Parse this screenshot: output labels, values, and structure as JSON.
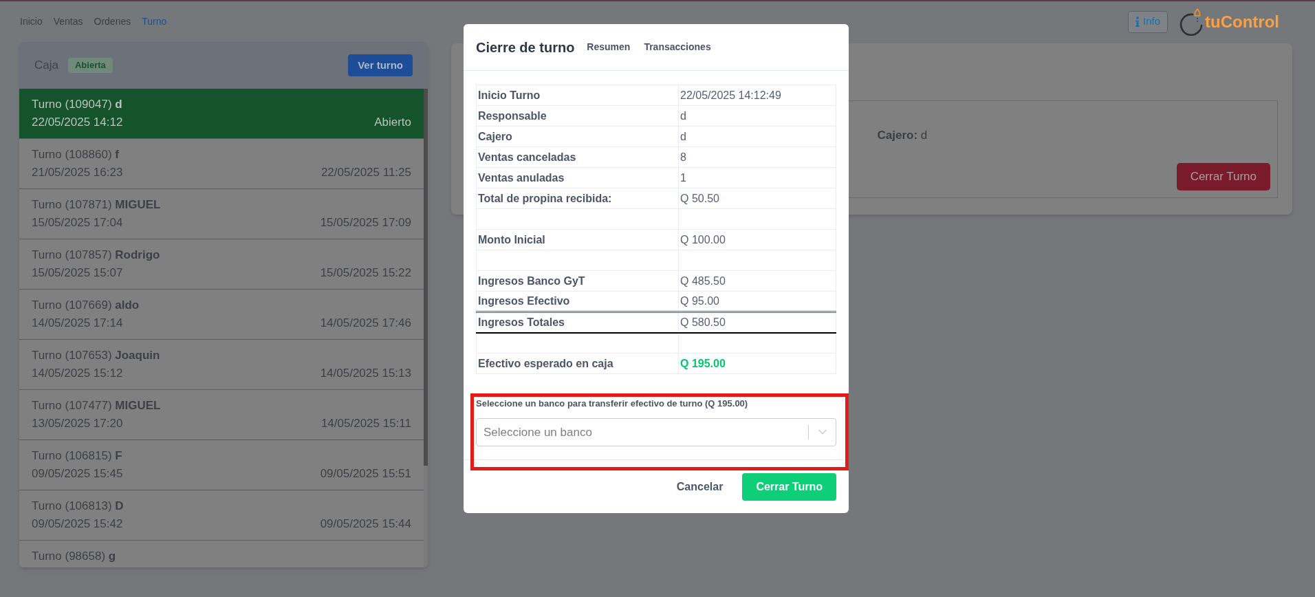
{
  "nav": {
    "items": [
      {
        "label": "Inicio",
        "selected": false
      },
      {
        "label": "Ventas",
        "selected": false
      },
      {
        "label": "Ordenes",
        "selected": false
      },
      {
        "label": "Turno",
        "selected": true
      }
    ]
  },
  "header": {
    "info_button": "Info",
    "logo_text": "tuControl"
  },
  "register": {
    "title": "Caja",
    "status_badge": "Abierta",
    "view_shift_button": "Ver turno",
    "shifts": [
      {
        "title": "Turno (109047) **d**",
        "start": "22/05/2025 14:12",
        "status": "Abierto",
        "selected": true
      },
      {
        "title": "Turno (108860) **f**",
        "start": "21/05/2025 16:23",
        "end": "22/05/2025 11:25",
        "selected": false
      },
      {
        "title": "Turno (107871) **MIGUEL**",
        "start": "15/05/2025 17:04",
        "end": "15/05/2025 17:09",
        "selected": false
      },
      {
        "title": "Turno (107857) **Rodrigo**",
        "start": "15/05/2025 15:07",
        "end": "15/05/2025 15:22",
        "selected": false
      },
      {
        "title": "Turno (107669) **aldo**",
        "start": "14/05/2025 17:14",
        "end": "14/05/2025 17:46",
        "selected": false
      },
      {
        "title": "Turno (107653) **Joaquin**",
        "start": "14/05/2025 15:12",
        "end": "14/05/2025 15:13",
        "selected": false
      },
      {
        "title": "Turno (107477) **MIGUEL**",
        "start": "13/05/2025 17:20",
        "end": "14/05/2025 15:11",
        "selected": false
      },
      {
        "title": "Turno (106815) **F**",
        "start": "09/05/2025 15:45",
        "end": "09/05/2025 15:51",
        "selected": false
      },
      {
        "title": "Turno (106813) **D**",
        "start": "09/05/2025 15:42",
        "end": "09/05/2025 15:44",
        "selected": false
      },
      {
        "title": "Turno (98658) **g**",
        "selected": false
      }
    ]
  },
  "shift_detail": {
    "cashier": "**Cajero:** d",
    "close_button": "Cerrar Turno"
  },
  "modal": {
    "title": "Cierre de turno",
    "tabs": [
      "Resumen",
      "Transacciones"
    ],
    "summary": [
      {
        "kind": "field",
        "label": "Inicio Turno",
        "value": "22/05/2025 14:12:49"
      },
      {
        "kind": "field",
        "label": "Responsable",
        "value": "d"
      },
      {
        "kind": "field",
        "label": "Cajero",
        "value": "d"
      },
      {
        "kind": "field",
        "label": "Ventas canceladas",
        "value": "8"
      },
      {
        "kind": "field",
        "label": "Ventas anuladas",
        "value": "1"
      },
      {
        "kind": "field",
        "label": "Total de propina recibida:",
        "value": "Q 50.50"
      },
      {
        "kind": "spacer"
      },
      {
        "kind": "field",
        "label": "Monto Inicial",
        "value": "Q 100.00"
      },
      {
        "kind": "spacer"
      },
      {
        "kind": "field",
        "label": "Ingresos Banco GyT",
        "value": "Q 485.50"
      },
      {
        "kind": "field",
        "label": "Ingresos Efectivo",
        "value": "Q 95.00"
      },
      {
        "kind": "total",
        "label": "Ingresos Totales",
        "value": "Q 580.50"
      },
      {
        "kind": "spacer"
      },
      {
        "kind": "expected",
        "label": "Efectivo esperado en caja",
        "value": "Q 195.00"
      }
    ],
    "bank_transfer": {
      "label": "Seleccione un banco para transferir efectivo de turno (Q 195.00)",
      "placeholder": "Seleccione un banco",
      "highlighted": true
    },
    "buttons": {
      "cancel": "Cancelar",
      "confirm": "Cerrar Turno"
    }
  }
}
